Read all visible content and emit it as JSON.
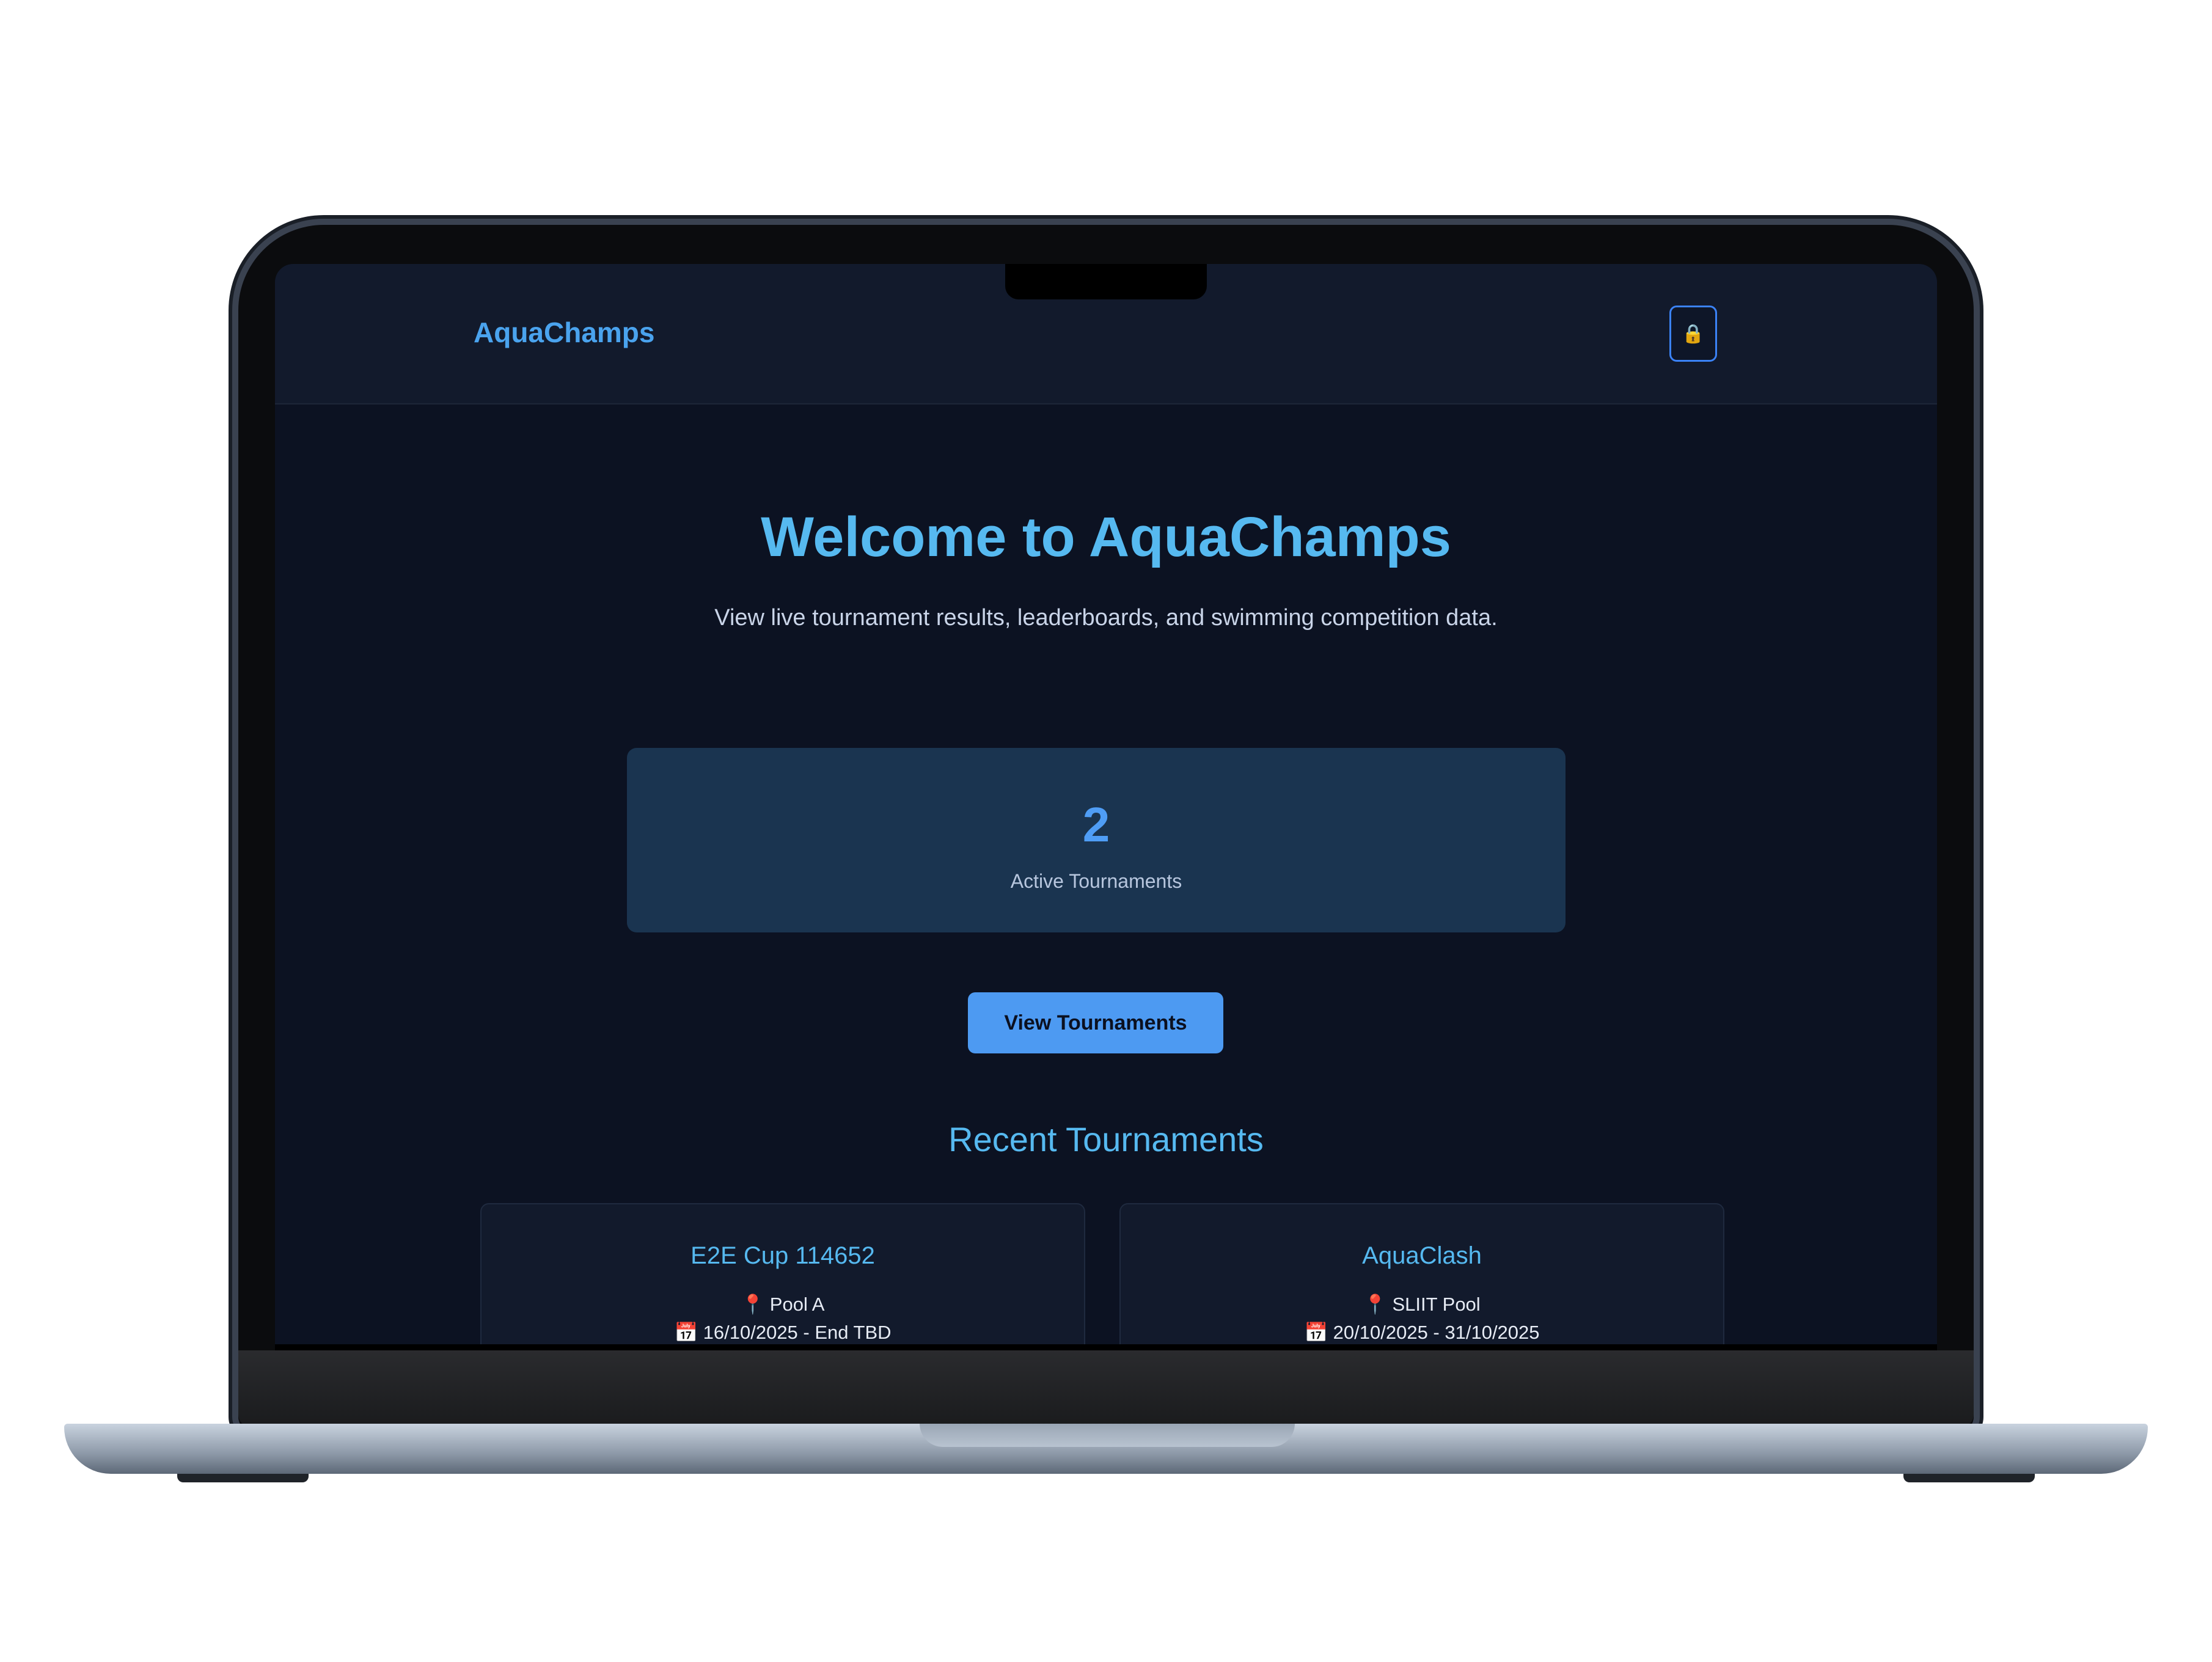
{
  "navbar": {
    "brand": "AquaChamps",
    "lock_icon": "🔒"
  },
  "hero": {
    "title": "Welcome to AquaChamps",
    "subtitle": "View live tournament results, leaderboards, and swimming competition data."
  },
  "stats": {
    "value": "2",
    "label": "Active Tournaments"
  },
  "cta": {
    "label": "View Tournaments"
  },
  "recent": {
    "title": "Recent Tournaments",
    "items": [
      {
        "name": "E2E Cup 114652",
        "location": "📍 Pool A",
        "dates": "📅 16/10/2025 - End TBD"
      },
      {
        "name": "AquaClash",
        "location": "📍 SLIIT Pool",
        "dates": "📅 20/10/2025 - 31/10/2025"
      }
    ]
  },
  "colors": {
    "accent": "#56b9f0",
    "brand": "#4aa3ee",
    "button": "#4d9af2",
    "background": "#0c1222"
  }
}
